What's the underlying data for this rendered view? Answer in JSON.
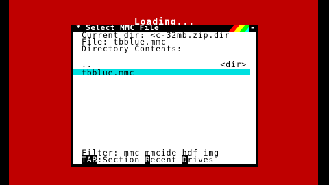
{
  "screen": {
    "status_text": "Loading...",
    "border_color": "#bf0000"
  },
  "window": {
    "title": "* Select MMC File",
    "close_symbol": "-",
    "rainbow_colors": [
      "#ff0000",
      "#ffff00",
      "#00ff00",
      "#00ffff"
    ]
  },
  "info": {
    "current_dir": "Current dir: <c-32mb.zip.dir",
    "file": "File: tbblue.mmc",
    "directory_heading": "Directory Contents:"
  },
  "directory_entries": [
    {
      "name": "..",
      "tag": "<dir>",
      "selected": false
    },
    {
      "name": "tbblue.mmc",
      "tag": "",
      "selected": true
    }
  ],
  "footer": {
    "filter": "Filter: mmc mmcide hdf img",
    "shortcuts": [
      {
        "key": "TAB",
        "rest": ":Section "
      },
      {
        "key": "R",
        "rest": "ecent "
      },
      {
        "key": "D",
        "rest": "rives"
      }
    ]
  },
  "colors": {
    "selection": "#00e0e0",
    "panel_background": "#ffffff",
    "text": "#000000"
  }
}
